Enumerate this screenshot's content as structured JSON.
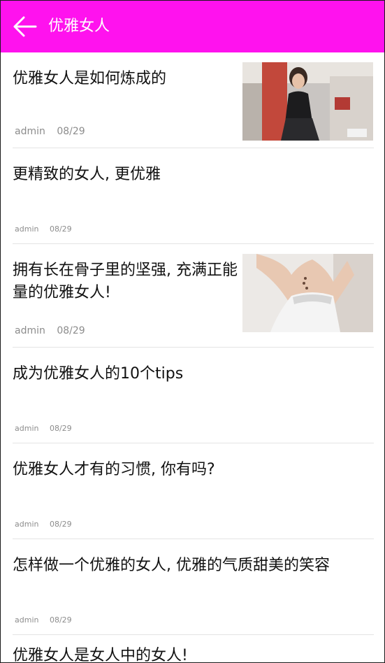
{
  "header": {
    "back_icon": "arrow-left-icon",
    "title": "优雅女人",
    "bg_color": "#ff12ee"
  },
  "articles": [
    {
      "title": "优雅女人是如何炼成的",
      "author": "admin",
      "date": "08/29",
      "has_image": true
    },
    {
      "title": "更精致的女人, 更优雅",
      "author": "admin",
      "date": "08/29",
      "has_image": false
    },
    {
      "title": "拥有长在骨子里的坚强, 充满正能量的优雅女人!",
      "author": "admin",
      "date": "08/29",
      "has_image": true
    },
    {
      "title": "成为优雅女人的10个tips",
      "author": "admin",
      "date": "08/29",
      "has_image": false
    },
    {
      "title": "优雅女人才有的习惯, 你有吗?",
      "author": "admin",
      "date": "08/29",
      "has_image": false
    },
    {
      "title": "怎样做一个优雅的女人, 优雅的气质甜美的笑容",
      "author": "admin",
      "date": "08/29",
      "has_image": false
    },
    {
      "title": "优雅女人是女人中的女人!",
      "author": "",
      "date": "",
      "has_image": false
    }
  ]
}
